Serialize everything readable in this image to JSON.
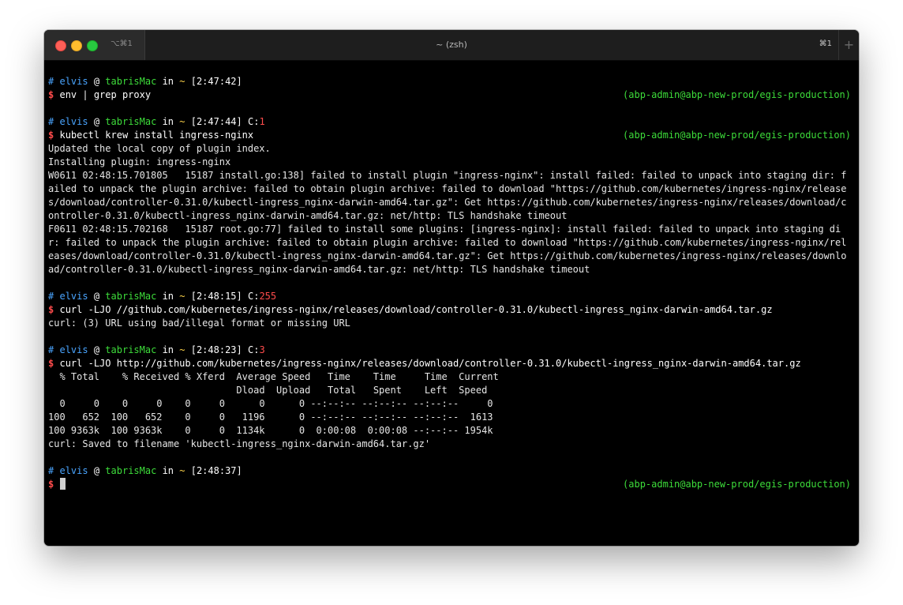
{
  "window": {
    "tab_shortcut": "⌥⌘1",
    "title": "~ (zsh)",
    "right_shortcut": "⌘1",
    "new_tab_symbol": "+"
  },
  "prompt": {
    "hash": "#",
    "user": "elvis",
    "at": "@",
    "host": "tabrisMac",
    "in": "in",
    "dir": "~",
    "dollar": "$",
    "rprompt": "(abp-admin@abp-new-prod/egis-production)"
  },
  "blocks": [
    {
      "time": "[2:47:42]",
      "exit": "",
      "command": "env | grep proxy",
      "output": []
    },
    {
      "time": "[2:47:44]",
      "exit": "1",
      "command": "kubectl krew install ingress-nginx",
      "output": [
        "Updated the local copy of plugin index.",
        "Installing plugin: ingress-nginx",
        "W0611 02:48:15.701805   15187 install.go:138] failed to install plugin \"ingress-nginx\": install failed: failed to unpack into staging dir: failed to unpack the plugin archive: failed to obtain plugin archive: failed to download \"https://github.com/kubernetes/ingress-nginx/releases/download/controller-0.31.0/kubectl-ingress_nginx-darwin-amd64.tar.gz\": Get https://github.com/kubernetes/ingress-nginx/releases/download/controller-0.31.0/kubectl-ingress_nginx-darwin-amd64.tar.gz: net/http: TLS handshake timeout",
        "F0611 02:48:15.702168   15187 root.go:77] failed to install some plugins: [ingress-nginx]: install failed: failed to unpack into staging dir: failed to unpack the plugin archive: failed to obtain plugin archive: failed to download \"https://github.com/kubernetes/ingress-nginx/releases/download/controller-0.31.0/kubectl-ingress_nginx-darwin-amd64.tar.gz\": Get https://github.com/kubernetes/ingress-nginx/releases/download/controller-0.31.0/kubectl-ingress_nginx-darwin-amd64.tar.gz: net/http: TLS handshake timeout"
      ]
    },
    {
      "time": "[2:48:15]",
      "exit": "255",
      "command": "curl -LJO //github.com/kubernetes/ingress-nginx/releases/download/controller-0.31.0/kubectl-ingress_nginx-darwin-amd64.tar.gz",
      "output": [
        "curl: (3) URL using bad/illegal format or missing URL"
      ]
    },
    {
      "time": "[2:48:23]",
      "exit": "3",
      "command": "curl -LJO http://github.com/kubernetes/ingress-nginx/releases/download/controller-0.31.0/kubectl-ingress_nginx-darwin-amd64.tar.gz",
      "output": [
        "  % Total    % Received % Xferd  Average Speed   Time    Time     Time  Current",
        "                                 Dload  Upload   Total   Spent    Left  Speed",
        "  0     0    0     0    0     0      0      0 --:--:-- --:--:-- --:--:--     0",
        "100   652  100   652    0     0   1196      0 --:--:-- --:--:-- --:--:--  1613",
        "100 9363k  100 9363k    0     0  1134k      0  0:00:08  0:00:08 --:--:-- 1954k",
        "curl: Saved to filename 'kubectl-ingress_nginx-darwin-amd64.tar.gz'"
      ]
    }
  ],
  "final_prompt": {
    "time": "[2:48:37]"
  }
}
